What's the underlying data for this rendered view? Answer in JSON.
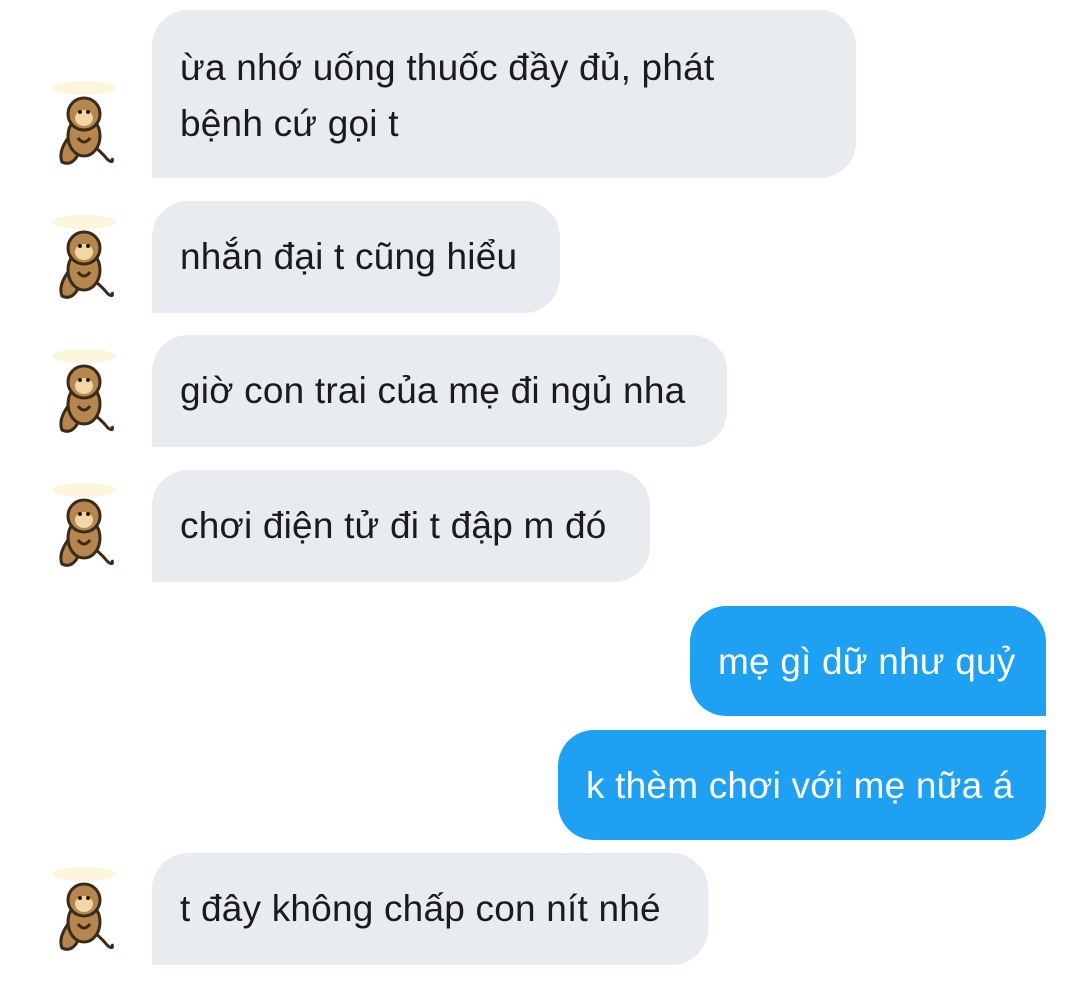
{
  "messages": [
    {
      "id": "m1",
      "direction": "incoming",
      "lines": [
        "ừa nhớ uống thuốc đầy đủ, phát",
        "bệnh cứ gọi t"
      ]
    },
    {
      "id": "m2",
      "direction": "incoming",
      "text": "nhắn đại t cũng hiểu"
    },
    {
      "id": "m3",
      "direction": "incoming",
      "text": "giờ con trai của mẹ đi ngủ nha"
    },
    {
      "id": "m4",
      "direction": "incoming",
      "text": "chơi điện tử đi t đập m đó"
    },
    {
      "id": "m5",
      "direction": "outgoing",
      "text": "mẹ gì dữ như quỷ"
    },
    {
      "id": "m6",
      "direction": "outgoing",
      "text": "k thèm chơi với mẹ nữa á"
    },
    {
      "id": "m7",
      "direction": "incoming",
      "text": "t đây không chấp con nít nhé"
    }
  ],
  "avatar_icon": "monkey-sticker-avatar",
  "colors": {
    "incoming_bubble": "#e8ebef",
    "outgoing_bubble": "#1ea1f2",
    "incoming_text": "#1b1b1b",
    "outgoing_text": "#ffffff"
  }
}
